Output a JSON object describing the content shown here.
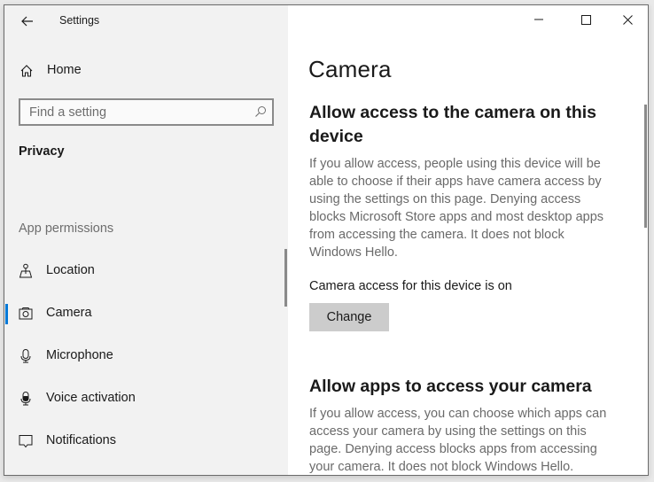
{
  "window": {
    "title": "Settings",
    "controls": {
      "minimize": "minimize-icon",
      "maximize": "maximize-icon",
      "close": "close-icon"
    }
  },
  "sidebar": {
    "back_icon": "back-arrow-icon",
    "home": {
      "label": "Home",
      "icon": "home-icon"
    },
    "search": {
      "placeholder": "Find a setting",
      "value": "",
      "icon": "search-icon"
    },
    "section_heading": "Privacy",
    "group_heading": "App permissions",
    "items": [
      {
        "label": "Location",
        "icon": "location-icon",
        "selected": false
      },
      {
        "label": "Camera",
        "icon": "camera-icon",
        "selected": true
      },
      {
        "label": "Microphone",
        "icon": "microphone-icon",
        "selected": false
      },
      {
        "label": "Voice activation",
        "icon": "voice-activation-icon",
        "selected": false
      },
      {
        "label": "Notifications",
        "icon": "notifications-icon",
        "selected": false
      }
    ]
  },
  "content": {
    "page_title": "Camera",
    "device_section": {
      "heading": "Allow access to the camera on this device",
      "description": "If you allow access, people using this device will be able to choose if their apps have camera access by using the settings on this page. Denying access blocks Microsoft Store apps and most desktop apps from accessing the camera. It does not block Windows Hello.",
      "status": "Camera access for this device is on",
      "button_label": "Change"
    },
    "apps_section": {
      "heading": "Allow apps to access your camera",
      "description": "If you allow access, you can choose which apps can access your camera by using the settings on this page. Denying access blocks apps from accessing your camera. It does not block Windows Hello."
    }
  },
  "colors": {
    "accent": "#0078d7",
    "sidebar_bg": "#f2f2f2",
    "button_bg": "#cccccc"
  }
}
